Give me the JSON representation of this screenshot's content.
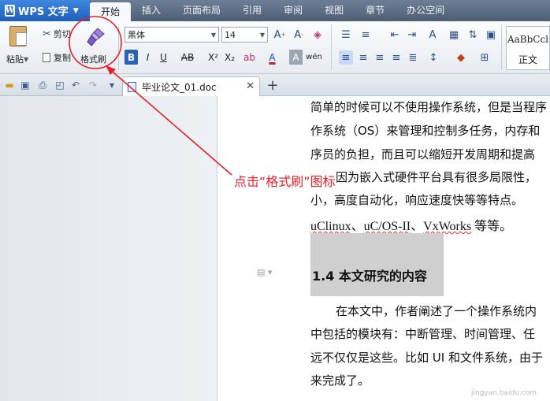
{
  "app": {
    "name": "WPS 文字"
  },
  "menu": {
    "tabs": [
      "开始",
      "插入",
      "页面布局",
      "引用",
      "审阅",
      "视图",
      "章节",
      "办公空间"
    ],
    "active": 0
  },
  "clipboard": {
    "paste": "粘贴",
    "cut": "剪切",
    "copy": "复制",
    "format_painter": "格式刷"
  },
  "font": {
    "family": "黑体",
    "size": "14"
  },
  "styles": {
    "sample": "AaBbCcl",
    "name": "正文"
  },
  "document_tab": {
    "title": "毕业论文_01.doc"
  },
  "document": {
    "lines": [
      "简单的时候可以不使用操作系统，但是当程序",
      "作系统（OS）来管理和控制多任务，内存和",
      "序员的负担，而且可以缩短开发周期和提高",
      "因为嵌入式硬件平台具有很多局限性，",
      "小，高度自动化，响应速度快等等特点。"
    ],
    "rtos_list": [
      {
        "name": "uClinux",
        "sep": "、"
      },
      {
        "name": "uC/OS-II",
        "sep": "、"
      },
      {
        "name": "VxWorks",
        "sep": ""
      }
    ],
    "rtos_suffix": "等等。",
    "heading": "1.4 本文研究的内容",
    "body_lines": [
      "在本文中，作者阐述了一个操作系统内",
      "中包括的模块有：中断管理、时间管理、任",
      "远不仅仅是这些。比如 UI 和文件系统，由于",
      "来完成了。"
    ]
  },
  "annotation": {
    "text": "点击“格式刷”图标",
    "color": "#e8202a"
  },
  "watermark": "jingyan.baidu.com",
  "colors": {
    "accent": "#2a62b8",
    "annotation": "#e8202a"
  }
}
